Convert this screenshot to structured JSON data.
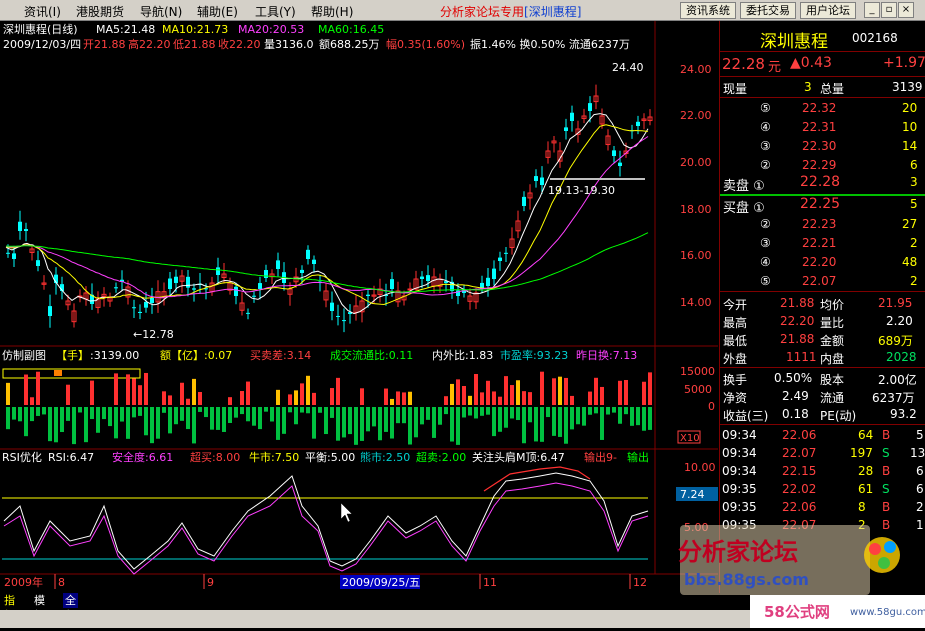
{
  "menu": {
    "items": [
      "资讯(I)",
      "港股期货",
      "导航(N)",
      "辅助(E)",
      "工具(Y)",
      "帮助(H)"
    ],
    "brand": "分析家论坛专用",
    "stock_tag": "[深圳惠程]",
    "buttons": [
      "资讯系统",
      "委托交易",
      "用户论坛"
    ]
  },
  "kline": {
    "title": "深圳惠程(日线)",
    "ma5": "MA5:21.48",
    "ma10": "MA10:21.73",
    "ma20": "MA20:20.53",
    "ma60": "MA60:16.45",
    "info_date": "2009/12/03/四",
    "info_open": "开21.88",
    "info_high": "高22.20",
    "info_low": "低21.88",
    "info_close": "收22.20",
    "info_vol": "量3136.0",
    "info_amt": "额688.25万",
    "info_chg": "幅0.35(1.60%)",
    "info_rest": "振1.46% 换0.50% 流通6237万",
    "price_labels": [
      "24.00",
      "22.00",
      "20.00",
      "18.00",
      "16.00",
      "14.00"
    ],
    "high_mark": "24.40",
    "low_mark": "←12.78",
    "range_mark": "19.13-19.30"
  },
  "vol_panel": {
    "title": "仿制副图",
    "unit": "【手】",
    "vol": ":3139.00",
    "amt": "额【亿】:0.07",
    "spread": "买卖差:3.14",
    "ratio": "成交流通比:0.11",
    "inout": "内外比:1.83",
    "pe": "市盈率:93.23",
    "turnover": "昨日换:7.13",
    "axis": [
      "15000",
      "5000",
      "0"
    ],
    "scale": "X10"
  },
  "rsi_panel": {
    "title": "RSI优化",
    "rsi": "RSI:6.47",
    "safe": "安全度:6.61",
    "overbuy": "超买:8.00",
    "bull": "牛市:7.50",
    "balance": "平衡:5.00",
    "bear": "熊市:2.50",
    "oversell": "超卖:2.00",
    "focus": "关注头肩M顶:6.47",
    "out": "输出9-",
    "out2": "输出",
    "axis": [
      "10.00",
      "7.24",
      "5.00"
    ],
    "current": "7.24"
  },
  "xaxis": {
    "labels": [
      "2009年",
      "8",
      "9",
      "2009/09/25/五",
      "11",
      "12"
    ]
  },
  "quote": {
    "name": "深圳惠程",
    "code": "002168",
    "price": "22.28",
    "unit": "元",
    "change": "▲0.43",
    "pct": "+1.97",
    "now_label": "现量",
    "now_val": "3",
    "total_label": "总量",
    "total_val": "3139",
    "asks": [
      {
        "lv": "⑤",
        "p": "22.32",
        "v": "20"
      },
      {
        "lv": "④",
        "p": "22.31",
        "v": "10"
      },
      {
        "lv": "③",
        "p": "22.30",
        "v": "14"
      },
      {
        "lv": "②",
        "p": "22.29",
        "v": "6"
      }
    ],
    "ask1_label": "卖盘 ①",
    "ask1_p": "22.28",
    "ask1_v": "3",
    "bid1_label": "买盘 ①",
    "bid1_p": "22.25",
    "bid1_v": "5",
    "bids": [
      {
        "lv": "②",
        "p": "22.23",
        "v": "27"
      },
      {
        "lv": "③",
        "p": "22.21",
        "v": "2"
      },
      {
        "lv": "④",
        "p": "22.20",
        "v": "48"
      },
      {
        "lv": "⑤",
        "p": "22.07",
        "v": "2"
      }
    ],
    "stats": [
      {
        "l1": "今开",
        "v1": "21.88",
        "l2": "均价",
        "v2": "21.95"
      },
      {
        "l1": "最高",
        "v1": "22.20",
        "l2": "量比",
        "v2": "2.20"
      },
      {
        "l1": "最低",
        "v1": "21.88",
        "l2": "金额",
        "v2": "689万"
      },
      {
        "l1": "外盘",
        "v1": "1111",
        "l2": "内盘",
        "v2": "2028"
      }
    ],
    "fin": [
      {
        "l1": "换手",
        "v1": "0.50%",
        "l2": "股本",
        "v2": "2.00亿"
      },
      {
        "l1": "净资",
        "v1": "2.49",
        "l2": "流通",
        "v2": "6237万"
      },
      {
        "l1": "收益(三)",
        "v1": "0.18",
        "l2": "PE(动)",
        "v2": "93.2"
      }
    ],
    "ticks": [
      {
        "t": "09:34",
        "p": "22.06",
        "v": "64",
        "s": "B",
        "n": "5"
      },
      {
        "t": "09:34",
        "p": "22.07",
        "v": "197",
        "s": "S",
        "n": "13"
      },
      {
        "t": "09:34",
        "p": "22.15",
        "v": "28",
        "s": "B",
        "n": "6"
      },
      {
        "t": "09:35",
        "p": "22.02",
        "v": "61",
        "s": "S",
        "n": "6"
      },
      {
        "t": "09:35",
        "p": "22.06",
        "v": "8",
        "s": "B",
        "n": "2"
      },
      {
        "t": "09:35",
        "p": "22.07",
        "v": "2",
        "s": "B",
        "n": "1"
      }
    ]
  },
  "tabs": [
    "指标",
    "模板",
    "全部"
  ],
  "watermark": {
    "title": "分析家论坛",
    "url": "bbs.88gs.com",
    "site": "58公式网",
    "site_url": "www.58gu.com"
  },
  "colors": {
    "up": "#ff4040",
    "down": "#00ffff",
    "ma5": "#ffffff",
    "ma10": "#ffff00",
    "ma20": "#ff40ff",
    "ma60": "#00ff00"
  }
}
